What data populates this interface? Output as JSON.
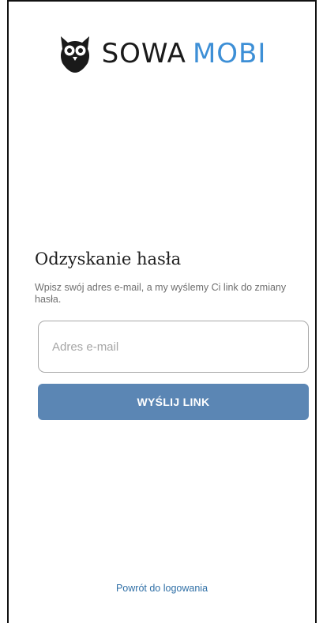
{
  "logo": {
    "icon": "owl-icon",
    "word1": "SOWA",
    "word2": "MOBI",
    "word2_color": "#3d8fd6"
  },
  "form": {
    "title": "Odzyskanie hasła",
    "description": "Wpisz swój adres e-mail, a my wyślemy Ci link do zmiany hasła.",
    "email_placeholder": "Adres e-mail",
    "email_value": "",
    "submit_label": "WYŚLIJ LINK",
    "button_color": "#5b86b4"
  },
  "footer": {
    "back_link": "Powrót do logowania"
  }
}
